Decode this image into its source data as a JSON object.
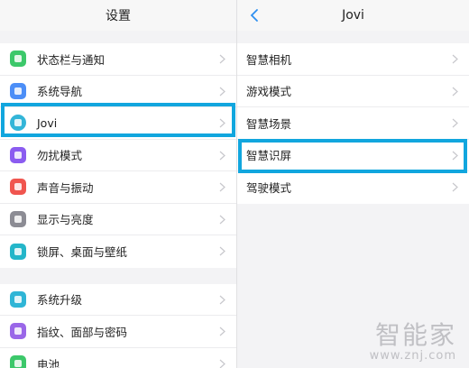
{
  "left_panel": {
    "title": "设置",
    "groups": [
      [
        {
          "label": "状态栏与通知",
          "icon": "notification-icon",
          "color": "#3cc86a"
        },
        {
          "label": "系统导航",
          "icon": "navigation-icon",
          "color": "#4c8ef7"
        },
        {
          "label": "Jovi",
          "icon": "jovi-icon",
          "color": "#33b5d8"
        },
        {
          "label": "勿扰模式",
          "icon": "moon-icon",
          "color": "#8b5cf0"
        },
        {
          "label": "声音与振动",
          "icon": "sound-icon",
          "color": "#f0554f"
        },
        {
          "label": "显示与亮度",
          "icon": "brightness-icon",
          "color": "#8c8c94"
        },
        {
          "label": "锁屏、桌面与壁纸",
          "icon": "wallpaper-icon",
          "color": "#24b6c9"
        }
      ],
      [
        {
          "label": "系统升级",
          "icon": "update-icon",
          "color": "#2fb5d6"
        },
        {
          "label": "指纹、面部与密码",
          "icon": "fingerprint-icon",
          "color": "#9a67e8"
        },
        {
          "label": "电池",
          "icon": "battery-icon",
          "color": "#3cc86a"
        }
      ]
    ]
  },
  "right_panel": {
    "title": "Jovi",
    "items": [
      {
        "label": "智慧相机"
      },
      {
        "label": "游戏模式"
      },
      {
        "label": "智慧场景"
      },
      {
        "label": "智慧识屏"
      },
      {
        "label": "驾驶模式"
      }
    ]
  },
  "watermark": {
    "text": "智能家",
    "url": "www.znj.com"
  },
  "colors": {
    "highlight": "#11a6de",
    "back_arrow": "#2e8ff0"
  }
}
